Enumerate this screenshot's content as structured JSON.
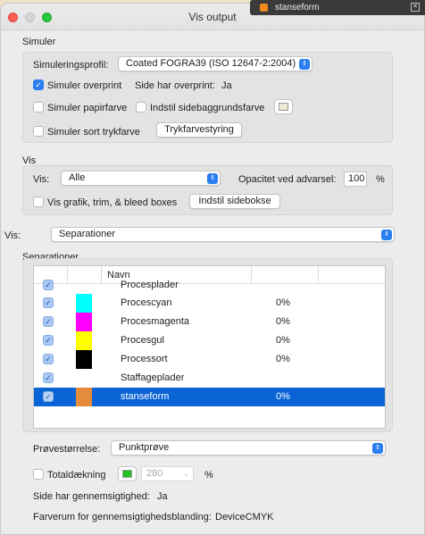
{
  "window": {
    "title": "Vis output"
  },
  "extension": {
    "title": "stanseform"
  },
  "simuler": {
    "heading": "Simuler",
    "profile_label": "Simuleringsprofil:",
    "profile_value": "Coated FOGRA39 (ISO 12647-2:2004)",
    "overprint_label": "Simuler overprint",
    "overprint_checked": true,
    "page_overprint_label": "Side har overprint:",
    "page_overprint_value": "Ja",
    "paper_color_label": "Simuler papirfarve",
    "page_bg_label": "Indstil sidebaggrundsfarve",
    "black_ink_label": "Simuler sort trykfarve",
    "ink_manager_button": "Trykfarvestyring"
  },
  "vis": {
    "heading": "Vis",
    "show_label": "Vis:",
    "show_value": "Alle",
    "opacity_label": "Opacitet ved advarsel:",
    "opacity_value": "100",
    "opacity_unit": "%",
    "boxes_label": "Vis grafik, trim, & bleed boxes",
    "page_boxes_button": "Indstil sidebokse"
  },
  "vis_mode": {
    "label": "Vis:",
    "value": "Separationer"
  },
  "separations": {
    "heading": "Separationer",
    "column_name": "Navn",
    "rows": [
      {
        "name": "Procesplader",
        "percent": "",
        "color": ""
      },
      {
        "name": "Procescyan",
        "percent": "0%",
        "color": "#00ffff"
      },
      {
        "name": "Procesmagenta",
        "percent": "0%",
        "color": "#ff00ff"
      },
      {
        "name": "Procesgul",
        "percent": "0%",
        "color": "#ffff00"
      },
      {
        "name": "Processort",
        "percent": "0%",
        "color": "#000000"
      },
      {
        "name": "Staffageplader",
        "percent": "",
        "color": ""
      },
      {
        "name": "stanseform",
        "percent": "0%",
        "color": "#e48b3c"
      }
    ]
  },
  "sample": {
    "label": "Prøvestørrelse:",
    "value": "Punktprøve"
  },
  "coverage": {
    "label": "Totaldækning",
    "swatch_color": "#22c022",
    "value": "280",
    "unit": "%"
  },
  "transparency": {
    "page_label": "Side har gennemsigtighed:",
    "page_value": "Ja",
    "blend_label": "Farverum for gennemsigtighedsblanding:",
    "blend_value": "DeviceCMYK"
  }
}
